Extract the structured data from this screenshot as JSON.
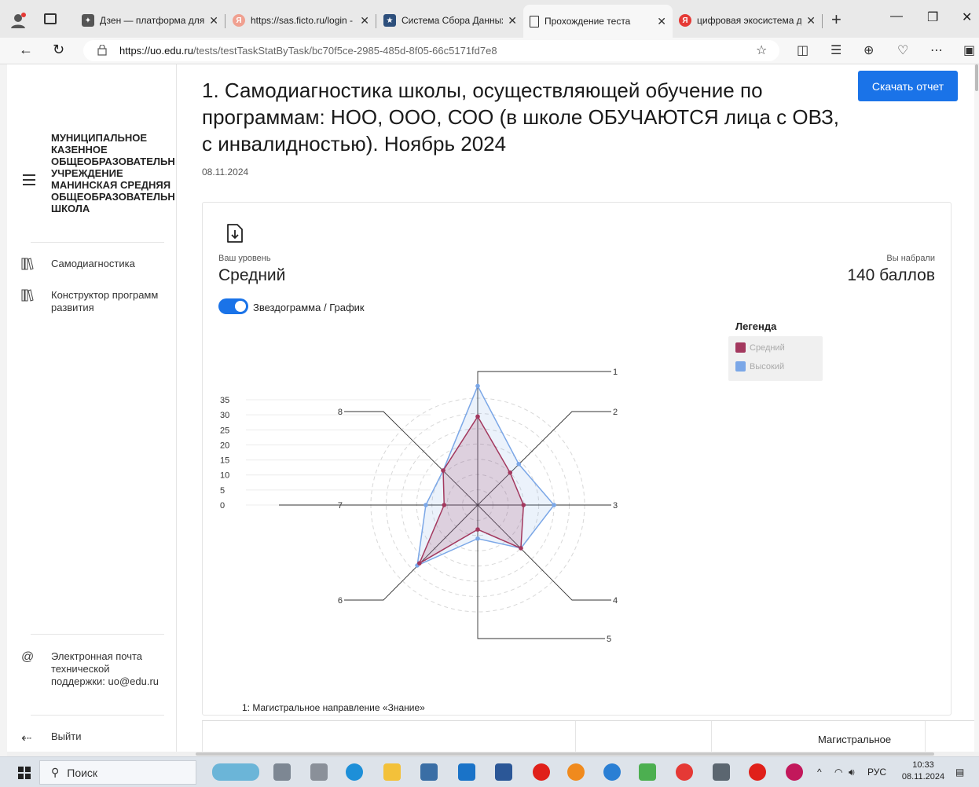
{
  "browser": {
    "tabs": [
      {
        "title": "Дзен — платформа для",
        "active": false
      },
      {
        "title": "https://sas.ficto.ru/login -",
        "active": false
      },
      {
        "title": "Система Сбора Данных",
        "active": false
      },
      {
        "title": "Прохождение теста",
        "active": true
      },
      {
        "title": "цифровая экосистема д",
        "active": false
      }
    ],
    "url_host": "https://uo.edu.ru",
    "url_path": "/tests/testTaskStatByTask/bc70f5ce-2985-485d-8f05-66c5171fd7e8"
  },
  "sidebar": {
    "org_name": "МУНИЦИПАЛЬНОЕ\nКАЗЕННОЕ\nОБЩЕОБРАЗОВАТЕЛЬН\nУЧРЕЖДЕНИЕ\nМАНИНСКАЯ СРЕДНЯЯ\nОБЩЕОБРАЗОВАТЕЛЬН\nШКОЛА",
    "items": [
      {
        "label": "Самодиагностика"
      },
      {
        "label": "Конструктор программ развития"
      }
    ],
    "support": "Электронная почта технической поддержки: uo@edu.ru",
    "logout": "Выйти"
  },
  "main": {
    "title": "1. Самодиагностика школы, осуществляющей обучение по программам: НОО, ООО, СОО (в школе ОБУЧАЮТСЯ лица с ОВЗ, с инвалидностью). Ноябрь 2024",
    "date": "08.11.2024",
    "download_label": "Скачать отчет",
    "level_label": "Ваш уровень",
    "level_value": "Средний",
    "score_label": "Вы набрали",
    "score_value": "140 баллов",
    "toggle_label": "Звездограмма / График",
    "legend_title": "Легенда",
    "section_caption": "1: Магистральное направление «Знание»",
    "table_header": "Магистральное"
  },
  "chart_data": {
    "type": "radar",
    "axes": [
      "1",
      "2",
      "3",
      "4",
      "5",
      "6",
      "7",
      "8"
    ],
    "ylim": [
      0,
      35
    ],
    "ticks": [
      0,
      5,
      10,
      15,
      20,
      25,
      30,
      35
    ],
    "series": [
      {
        "name": "Средний",
        "color": "#a3385e",
        "values": [
          29,
          15,
          15,
          20,
          8,
          27,
          11,
          16
        ]
      },
      {
        "name": "Высокий",
        "color": "#7ba7e7",
        "values": [
          39,
          19,
          25,
          20,
          11,
          28,
          17,
          16
        ]
      }
    ]
  },
  "taskbar": {
    "search_placeholder": "Поиск",
    "lang": "РУС",
    "time": "10:33",
    "date": "08.11.2024"
  },
  "colors": {
    "accent": "#1a73e8"
  }
}
